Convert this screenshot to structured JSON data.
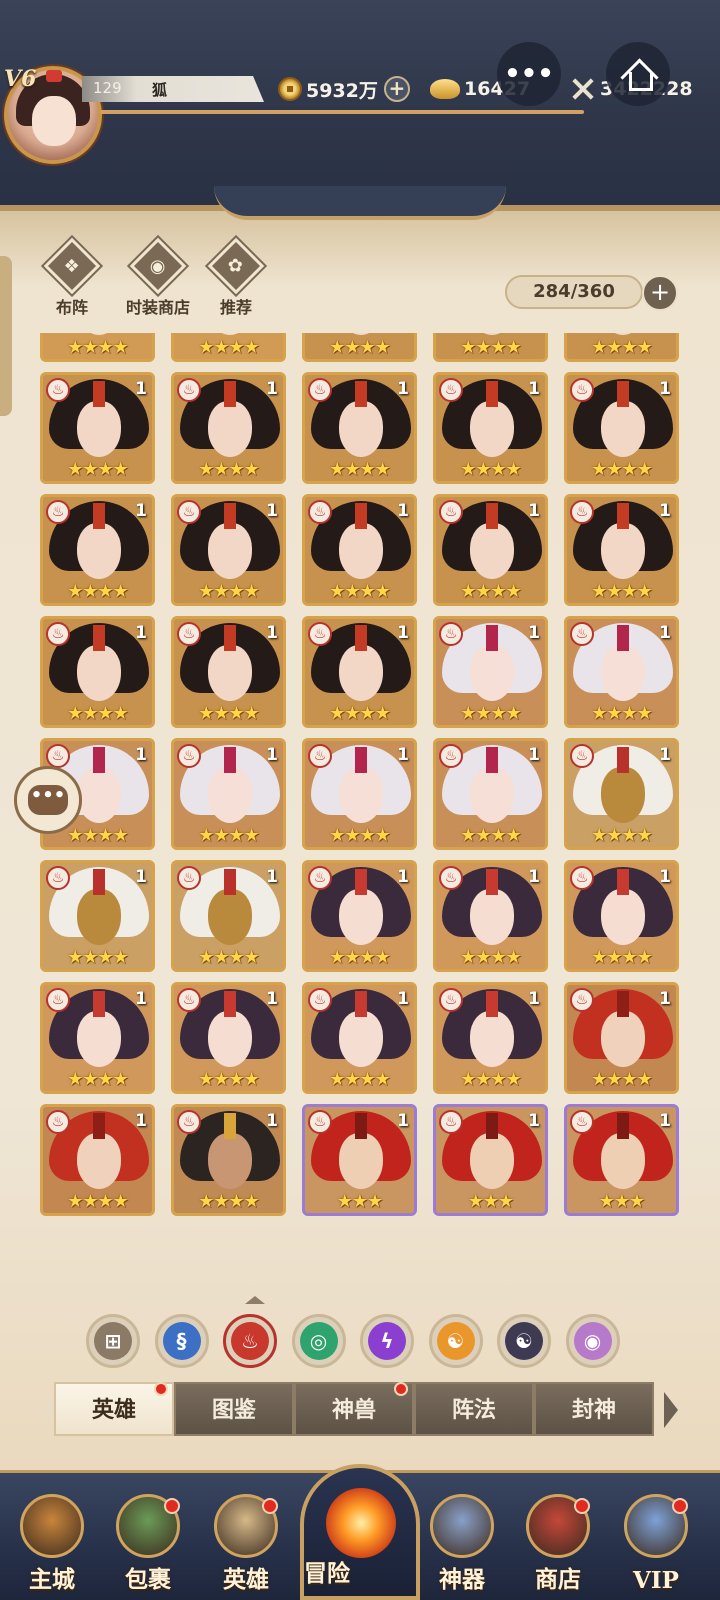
{
  "header": {
    "vip_level": "V6",
    "player_level": "129",
    "player_name": "狐",
    "gold": "5932万",
    "gold_plus": "+",
    "ingots": "16427",
    "power": "3422228",
    "more_button": "•••"
  },
  "toolbar": {
    "formation_label": "布阵",
    "fashion_shop_label": "时装商店",
    "recommend_label": "推荐",
    "hero_count": "284/360",
    "count_plus": "+"
  },
  "chat": {
    "label": "•••"
  },
  "hero_grid": {
    "element_badge_icon": "fire-element-icon",
    "rows": [
      [
        {
          "num": "",
          "stars": "★★★★",
          "portrait": "dark-haired-lady",
          "frame": "gold"
        },
        {
          "num": "",
          "stars": "★★★★",
          "portrait": "dark-haired-lady",
          "frame": "gold"
        },
        {
          "num": "",
          "stars": "★★★★",
          "portrait": "red-marked-lady",
          "frame": "gold"
        },
        {
          "num": "",
          "stars": "★★★★",
          "portrait": "red-marked-lady",
          "frame": "gold"
        },
        {
          "num": "",
          "stars": "★★★★",
          "portrait": "red-marked-lady",
          "frame": "gold"
        }
      ],
      [
        {
          "num": "1",
          "stars": "★★★★",
          "portrait": "red-marked-lady",
          "frame": "gold"
        },
        {
          "num": "1",
          "stars": "★★★★",
          "portrait": "red-marked-lady",
          "frame": "gold"
        },
        {
          "num": "1",
          "stars": "★★★★",
          "portrait": "red-marked-lady",
          "frame": "gold"
        },
        {
          "num": "1",
          "stars": "★★★★",
          "portrait": "red-marked-lady",
          "frame": "gold"
        },
        {
          "num": "1",
          "stars": "★★★★",
          "portrait": "red-marked-lady",
          "frame": "gold"
        }
      ],
      [
        {
          "num": "1",
          "stars": "★★★★",
          "portrait": "red-marked-lady",
          "frame": "gold"
        },
        {
          "num": "1",
          "stars": "★★★★",
          "portrait": "red-marked-lady",
          "frame": "gold"
        },
        {
          "num": "1",
          "stars": "★★★★",
          "portrait": "red-marked-lady",
          "frame": "gold"
        },
        {
          "num": "1",
          "stars": "★★★★",
          "portrait": "red-marked-lady",
          "frame": "gold"
        },
        {
          "num": "1",
          "stars": "★★★★",
          "portrait": "red-marked-lady",
          "frame": "gold"
        }
      ],
      [
        {
          "num": "1",
          "stars": "★★★★",
          "portrait": "red-marked-lady",
          "frame": "gold"
        },
        {
          "num": "1",
          "stars": "★★★★",
          "portrait": "red-marked-lady",
          "frame": "gold"
        },
        {
          "num": "1",
          "stars": "★★★★",
          "portrait": "red-marked-lady",
          "frame": "gold"
        },
        {
          "num": "1",
          "stars": "★★★★",
          "portrait": "white-haired-demon",
          "frame": "gold"
        },
        {
          "num": "1",
          "stars": "★★★★",
          "portrait": "white-haired-demon",
          "frame": "gold"
        }
      ],
      [
        {
          "num": "1",
          "stars": "★★★★",
          "portrait": "white-haired-demon",
          "frame": "gold"
        },
        {
          "num": "1",
          "stars": "★★★★",
          "portrait": "white-haired-demon",
          "frame": "gold"
        },
        {
          "num": "1",
          "stars": "★★★★",
          "portrait": "white-haired-demon",
          "frame": "gold"
        },
        {
          "num": "1",
          "stars": "★★★★",
          "portrait": "white-haired-demon",
          "frame": "gold"
        },
        {
          "num": "1",
          "stars": "★★★★",
          "portrait": "golden-mask-warrior",
          "frame": "gold"
        }
      ],
      [
        {
          "num": "1",
          "stars": "★★★★",
          "portrait": "golden-mask-warrior",
          "frame": "gold"
        },
        {
          "num": "1",
          "stars": "★★★★",
          "portrait": "golden-mask-warrior",
          "frame": "gold"
        },
        {
          "num": "1",
          "stars": "★★★★",
          "portrait": "purple-haired-lady",
          "frame": "gold"
        },
        {
          "num": "1",
          "stars": "★★★★",
          "portrait": "purple-haired-lady",
          "frame": "gold"
        },
        {
          "num": "1",
          "stars": "★★★★",
          "portrait": "purple-haired-lady",
          "frame": "gold"
        }
      ],
      [
        {
          "num": "1",
          "stars": "★★★★",
          "portrait": "purple-haired-lady",
          "frame": "gold"
        },
        {
          "num": "1",
          "stars": "★★★★",
          "portrait": "purple-haired-lady",
          "frame": "gold"
        },
        {
          "num": "1",
          "stars": "★★★★",
          "portrait": "purple-haired-lady",
          "frame": "gold"
        },
        {
          "num": "1",
          "stars": "★★★★",
          "portrait": "purple-haired-lady",
          "frame": "gold"
        },
        {
          "num": "1",
          "stars": "★★★★",
          "portrait": "red-haired-man",
          "frame": "gold"
        }
      ],
      [
        {
          "num": "1",
          "stars": "★★★★",
          "portrait": "red-haired-man",
          "frame": "gold"
        },
        {
          "num": "1",
          "stars": "★★★★",
          "portrait": "dark-haired-man",
          "frame": "gold"
        },
        {
          "num": "1",
          "stars": "★★★",
          "portrait": "red-haired-warrior",
          "frame": "purple"
        },
        {
          "num": "1",
          "stars": "★★★",
          "portrait": "red-haired-warrior",
          "frame": "purple"
        },
        {
          "num": "1",
          "stars": "★★★",
          "portrait": "red-haired-warrior",
          "frame": "purple"
        }
      ]
    ]
  },
  "element_filters": [
    {
      "name": "all-filter",
      "icon": "grid-icon",
      "glyph": "⊞",
      "color": "#8a7a66",
      "selected": false
    },
    {
      "name": "water-filter",
      "icon": "water-element-icon",
      "glyph": "§",
      "color": "#3d6fc4",
      "selected": false
    },
    {
      "name": "fire-filter",
      "icon": "fire-element-icon",
      "glyph": "♨",
      "color": "#c9382c",
      "selected": true
    },
    {
      "name": "wind-filter",
      "icon": "wind-element-icon",
      "glyph": "◎",
      "color": "#2fa36d",
      "selected": false
    },
    {
      "name": "thunder-filter",
      "icon": "thunder-element-icon",
      "glyph": "ϟ",
      "color": "#8a3fd0",
      "selected": false
    },
    {
      "name": "light-filter",
      "icon": "light-element-icon",
      "glyph": "☯",
      "color": "#e9972a",
      "selected": false
    },
    {
      "name": "dark-filter",
      "icon": "dark-element-icon",
      "glyph": "☯",
      "color": "#3d3a52",
      "selected": false
    },
    {
      "name": "chaos-filter",
      "icon": "chaos-element-icon",
      "glyph": "◉",
      "color": "#b779c9",
      "selected": false
    }
  ],
  "tabs": [
    {
      "label": "英雄",
      "active": true,
      "dot": true
    },
    {
      "label": "图鉴",
      "active": false,
      "dot": false
    },
    {
      "label": "神兽",
      "active": false,
      "dot": true
    },
    {
      "label": "阵法",
      "active": false,
      "dot": false
    },
    {
      "label": "封神",
      "active": false,
      "dot": false
    }
  ],
  "bottom_nav": [
    {
      "label": "主城",
      "icon": "main-city-icon",
      "dot": false
    },
    {
      "label": "包裹",
      "icon": "bag-icon",
      "dot": true
    },
    {
      "label": "英雄",
      "icon": "hero-icon",
      "dot": true
    },
    {
      "label": "冒险",
      "icon": "adventure-icon",
      "dot": false
    },
    {
      "label": "神器",
      "icon": "artifact-icon",
      "dot": false
    },
    {
      "label": "商店",
      "icon": "shop-icon",
      "dot": true
    },
    {
      "label": "VIP",
      "icon": "vip-icon",
      "dot": true
    }
  ],
  "colors": {
    "header_bg": "#2f364a",
    "panel_bg": "#efe6d6",
    "gold_frame": "#d6a24a",
    "purple_frame": "#9c7bd6",
    "star": "#ffd648",
    "red_dot": "#e02a1f"
  }
}
